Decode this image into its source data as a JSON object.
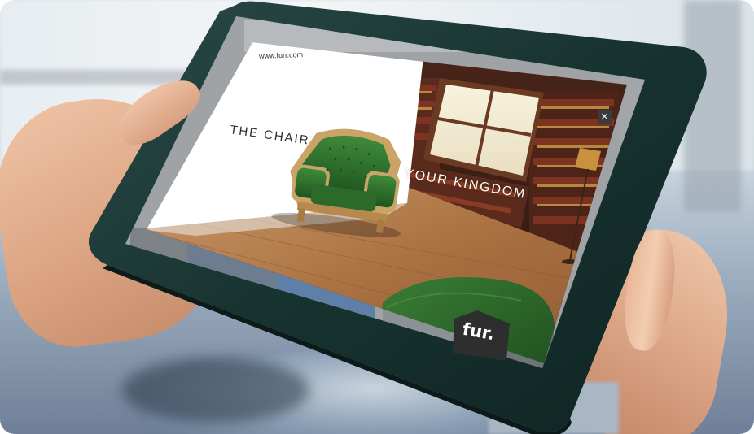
{
  "ad": {
    "url": "www.furr.com",
    "headline": "THE CHAIR",
    "tagline": "YOUR KINGDOM",
    "close_label": "×",
    "brand": "fur."
  },
  "colors": {
    "tablet_frame": "#1f3d3a",
    "chair_green": "#2f6b2c",
    "wood_floor": "#b07a4a",
    "brand_badge": "#2e2e2e"
  },
  "icons": [
    "close-icon",
    "brand-logo-icon"
  ]
}
